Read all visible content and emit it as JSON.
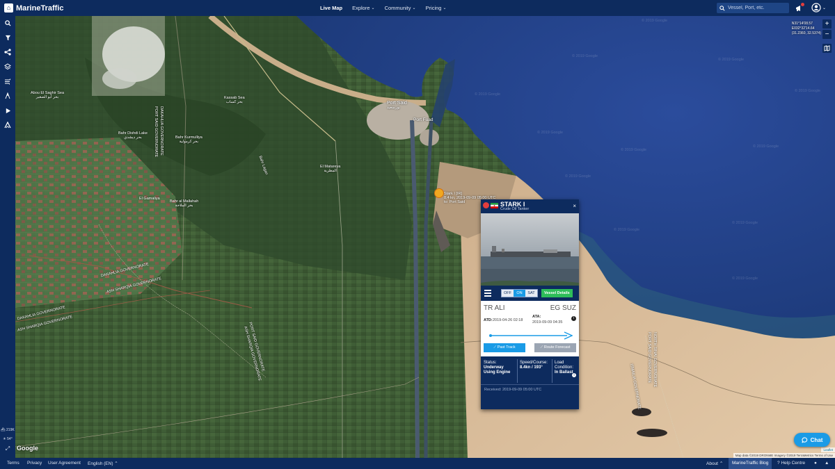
{
  "app": {
    "logo_text": "MarineTraffic"
  },
  "nav": {
    "items": [
      {
        "label": "Live Map",
        "active": true
      },
      {
        "label": "Explore",
        "chevron": "chevron-down-icon"
      },
      {
        "label": "Community",
        "chevron": "chevron-down-icon"
      },
      {
        "label": "Pricing",
        "chevron": "chevron-down-icon"
      }
    ]
  },
  "search": {
    "placeholder": "Vessel, Port, etc."
  },
  "sidebar": {
    "icons": [
      "search-icon",
      "filter-icon",
      "share-network-icon",
      "layers-icon",
      "weather-icon",
      "measure-icon",
      "play-icon",
      "routing-icon"
    ],
    "stats": {
      "vessels": "219K",
      "zoom": "54°"
    }
  },
  "map": {
    "coordinates": {
      "lat": "N31°14'08.57",
      "lon": "E032°32'14.64",
      "decimal": "(31.2360, 32.5374)"
    },
    "zoom_in": "+",
    "zoom_out": "−",
    "google": "Google",
    "attribution": "Map data ©2019 DRONME Imagery ©2019 TerraMetrics   Terms of Use",
    "leaflet": "Leaflet",
    "labels": {
      "port_said": "Port Said",
      "port_said_ar": "بورسعيد",
      "port_fuad": "Port Fuad",
      "kassab_sea": "Kassab Sea",
      "kassab_sea_ar": "بحر كساب",
      "abou_el_saghir": "Abou El Saghir Sea",
      "abou_el_saghir_ar": "بحر أبو الصغير",
      "bahr_dishdi": "Bahr Dishdi Lake",
      "bahr_dishdi_ar": "بحر ديشدي",
      "bahr_kurmulliya": "Bahr Kurmulliya",
      "bahr_kurmulliya_ar": "بحر كرمولية",
      "bahr_lagan": "Bahr Lagan",
      "el_matareya": "El Matareya",
      "el_matareya_ar": "المطرية",
      "bahr_al_mallahah": "Bahr al Mallahah",
      "bahr_al_mallahah_ar": "بحر الملاحة",
      "el_gamaliya": "El Gamaliya",
      "dakahlia_gov": "DAKAHLIA GOVERNORATE",
      "sharqia_gov": "ASH SHARQIA GOVERNORATE",
      "dakahlia_gov2": "DAKAHLIA GOVERNORATE",
      "sharqia_gov2": "ASH SHARQIA GOVERNORATE",
      "port_said_gov": "PORT SAID GOVERNORATE",
      "dakahlia_gov3": "DAKAHLIA GOVERNORATE",
      "port_said_gov2": "PORT SAID GOVERNORATE",
      "sharqia_gov3": "ASH SHARQIA GOVERNORATE",
      "north_sinai": "NORTH SINAI GOVERNORATE",
      "port_said_gov3": "PORT SAID GOVERNORATE",
      "ismailia_gov": "ISMAILIA GOVERNORATE",
      "watermark": "© 2019 Google"
    }
  },
  "ship": {
    "marker_label_line1": "Stark I [IR]",
    "marker_label_line2": "8.4 kn, 2019-09-09 05:00 UTC",
    "marker_label_line3": "to: Port Said"
  },
  "popup": {
    "vessel_name": "STARK I",
    "vessel_type": "Crude Oil Tanker",
    "close": "×",
    "toggle": [
      "OFF",
      "ON",
      "SAT"
    ],
    "toggle_selected": "ON",
    "vessel_details": "Vessel Details",
    "from_country": "TR",
    "from_port": "ALI",
    "to_country": "EG",
    "to_port": "SUZ",
    "atd_label": "ATD:",
    "atd_value": "2019-04-26 02:18",
    "ata_label": "ATA:",
    "ata_value": "2019-09-09 04:35",
    "progress": 1.0,
    "past_track": "Past Track",
    "route_forecast": "Route Forecast",
    "status_label": "Status:",
    "status_value": "Underway Using Engine",
    "speed_label": "Speed/Course:",
    "speed_value": "8.4kn / 193°",
    "load_label": "Load Condition:",
    "load_value": "In Ballast",
    "received": "Received: 2019-09-09 05:00 UTC"
  },
  "chat": {
    "label": "Chat"
  },
  "footer": {
    "terms": "Terms",
    "privacy": "Privacy",
    "user_agreement": "User Agreement",
    "language": "English (EN)",
    "about": "About",
    "blog": "MarineTraffic Blog",
    "help": "Help Centre"
  },
  "colors": {
    "brand": "#0d2b5e",
    "accent": "#1a9be6",
    "success": "#2ebd59",
    "marker": "#f1a821"
  }
}
